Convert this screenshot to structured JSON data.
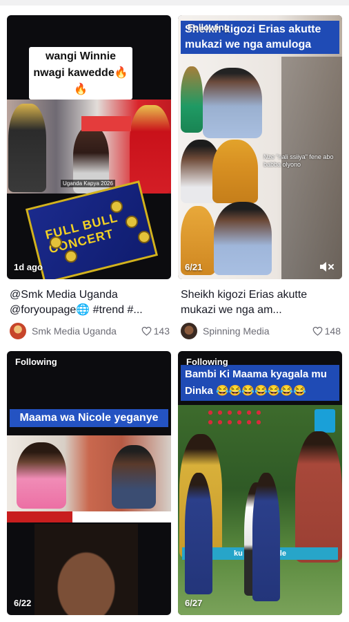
{
  "feed": {
    "cards": [
      {
        "following": "",
        "overlay_title": "wangi Winnie nwagi kawedde🔥🔥",
        "overlay_sub": "Uganda Kapya 2026",
        "poster_text": "FULL BULL CONCERT",
        "count": "1d ago",
        "caption": "@Smk Media Uganda @foryoupage🌐 #trend #...",
        "author": "Smk Media Uganda",
        "likes": "143",
        "avatar_color": "#c7452a"
      },
      {
        "following": "Following",
        "overlay_title": "Sheikh kigozi Erias akutte mukazi we nga amuloga",
        "overlay_note": "Nze \"nali ssiiya\" fene abo babba olyono",
        "count": "6/21",
        "caption": "Sheikh kigozi Erias akutte mukazi we nga am...",
        "author": "Spinning Media",
        "likes": "148",
        "avatar_color": "#3a2a22"
      },
      {
        "following": "Following",
        "overlay_title": "Maama wa Nicole yeganye",
        "count": "6/22"
      },
      {
        "following": "Following",
        "overlay_title": "Bambi Ki Maama kyagala mu Dinka 😂😂😂😂😂😂😂",
        "banner": "ku Afro Mobile",
        "count": "6/27"
      }
    ]
  },
  "colors": {
    "blue_banner": "#1f4bb5",
    "text_primary": "#161823",
    "text_secondary": "#6b6b74"
  }
}
